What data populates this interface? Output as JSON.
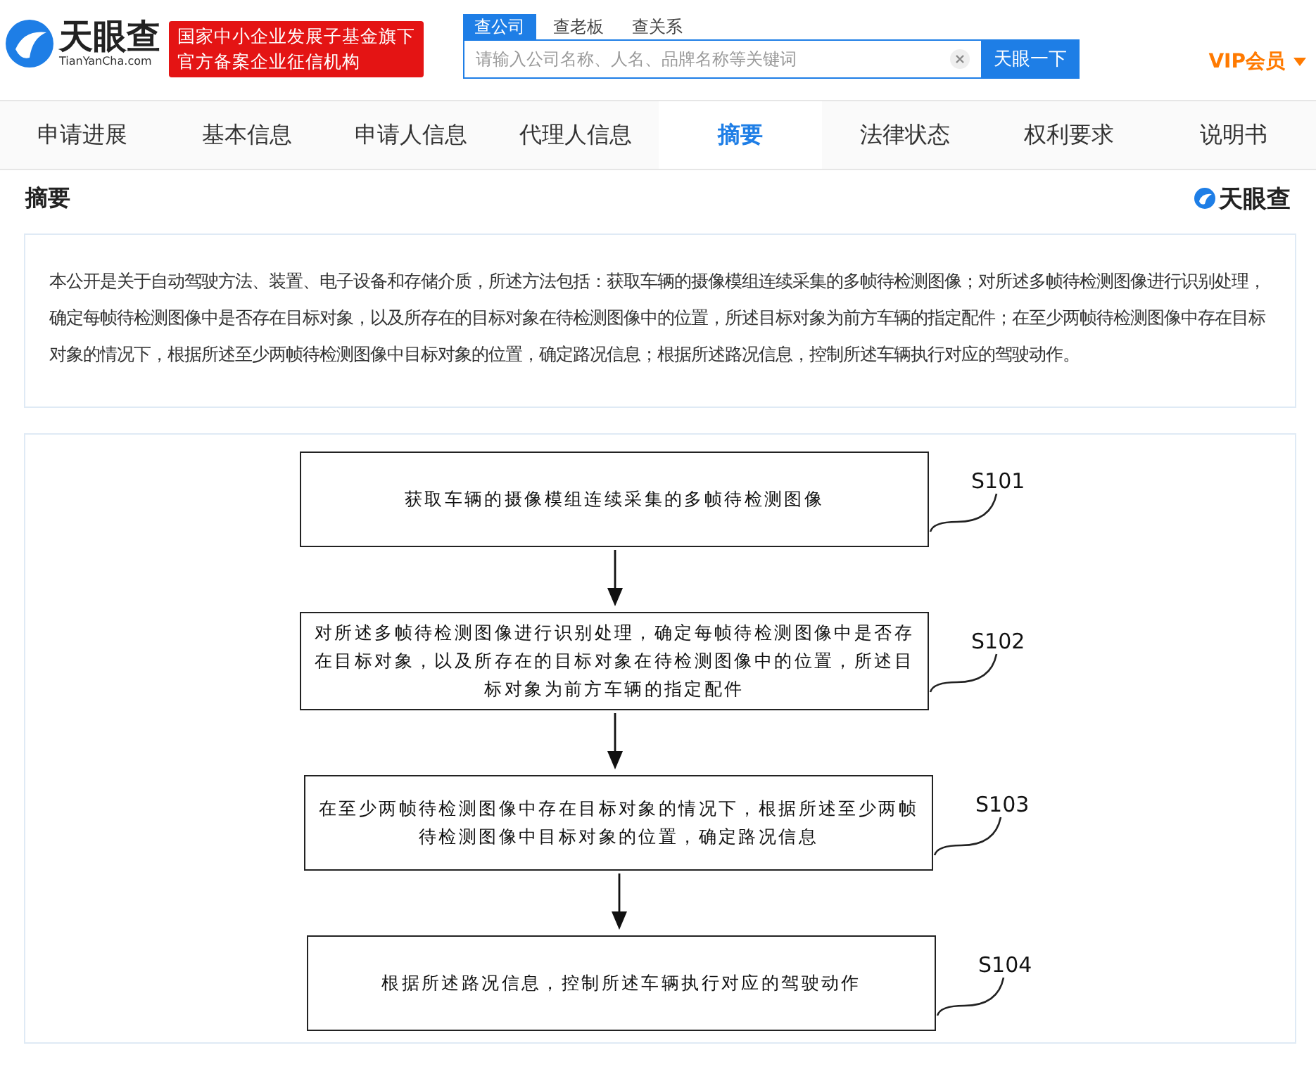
{
  "header": {
    "logo_text": "天眼查",
    "logo_domain": "TianYanCha.com",
    "banner_lines": [
      "国家中小企业发展子基金旗下",
      "官方备案企业征信机构"
    ],
    "search_tabs": [
      {
        "label": "查公司",
        "selected": true
      },
      {
        "label": "查老板",
        "selected": false
      },
      {
        "label": "查关系",
        "selected": false
      }
    ],
    "search": {
      "placeholder": "请输入公司名称、人名、品牌名称等关键词"
    },
    "search_button": "天眼一下",
    "vip": "VIP会员"
  },
  "nav_tabs": [
    {
      "label": "申请进展",
      "selected": false
    },
    {
      "label": "基本信息",
      "selected": false
    },
    {
      "label": "申请人信息",
      "selected": false
    },
    {
      "label": "代理人信息",
      "selected": false
    },
    {
      "label": "摘要",
      "selected": true
    },
    {
      "label": "法律状态",
      "selected": false
    },
    {
      "label": "权利要求",
      "selected": false
    },
    {
      "label": "说明书",
      "selected": false
    }
  ],
  "section": {
    "title": "摘要",
    "brand": "天眼查"
  },
  "abstract": "本公开是关于自动驾驶方法、装置、电子设备和存储介质，所述方法包括：获取车辆的摄像模组连续采集的多帧待检测图像；对所述多帧待检测图像进行识别处理，确定每帧待检测图像中是否存在目标对象，以及所存在的目标对象在待检测图像中的位置，所述目标对象为前方车辆的指定配件；在至少两帧待检测图像中存在目标对象的情况下，根据所述至少两帧待检测图像中目标对象的位置，确定路况信息；根据所述路况信息，控制所述车辆执行对应的驾驶动作。",
  "flowchart": {
    "steps": [
      {
        "label": "S101",
        "text": "获取车辆的摄像模组连续采集的多帧待检测图像"
      },
      {
        "label": "S102",
        "text": "对所述多帧待检测图像进行识别处理，确定每帧待检测图像中是否存在目标对象，以及所存在的目标对象在待检测图像中的位置，所述目标对象为前方车辆的指定配件"
      },
      {
        "label": "S103",
        "text": "在至少两帧待检测图像中存在目标对象的情况下，根据所述至少两帧待检测图像中目标对象的位置，确定路况信息"
      },
      {
        "label": "S104",
        "text": "根据所述路况信息，控制所述车辆执行对应的驾驶动作"
      }
    ]
  }
}
